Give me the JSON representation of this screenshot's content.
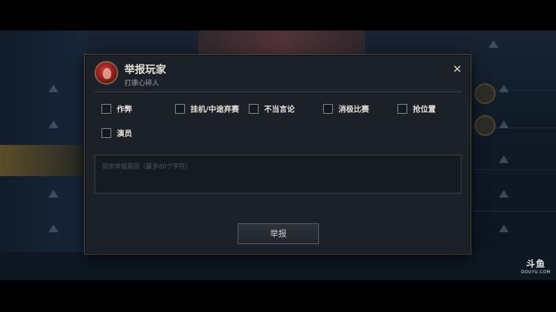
{
  "dialog": {
    "title": "举报玩家",
    "subtitle": "打康心碎人",
    "close_icon": "✕"
  },
  "options": [
    {
      "label": "作弊",
      "checked": false
    },
    {
      "label": "挂机/中途弃赛",
      "checked": false
    },
    {
      "label": "不当言论",
      "checked": false
    },
    {
      "label": "消极比赛",
      "checked": false
    },
    {
      "label": "抢位置",
      "checked": false
    },
    {
      "label": "演员",
      "checked": false
    }
  ],
  "reason": {
    "placeholder": "提供举报原因（最多80个字符）",
    "value": ""
  },
  "report_button": {
    "label": "举报"
  },
  "watermark": {
    "logo_text": "斗鱼",
    "domain_text": "DOUYU.COM"
  },
  "colors": {
    "accent_gold": "#5b5037",
    "panel_bg": "#1b2127"
  }
}
